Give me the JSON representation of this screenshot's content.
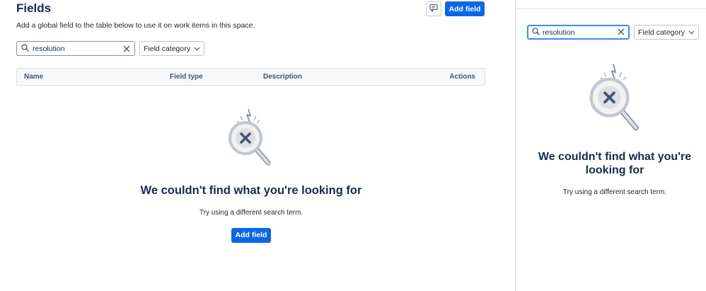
{
  "main": {
    "title": "Fields",
    "subtitle": "Add a global field to the table below to use it on work items in this space.",
    "add_field_label": "Add field",
    "feedback_icon": "feedback-icon",
    "search": {
      "value": "resolution",
      "icon": "search-icon",
      "clear_icon": "close-icon"
    },
    "category_filter": {
      "label": "Field category",
      "icon": "chevron-down-icon"
    },
    "table": {
      "columns": [
        "Name",
        "Field type",
        "Description",
        "Actions"
      ]
    },
    "empty_state": {
      "heading": "We couldn't find what you're looking for",
      "description": "Try using a different search term.",
      "button_label": "Add field",
      "illustration": "magnifier-no-results-icon"
    }
  },
  "side_panel": {
    "search": {
      "value": "resolution",
      "icon": "search-icon",
      "clear_icon": "close-icon"
    },
    "category_filter": {
      "label": "Field category",
      "icon": "chevron-down-icon"
    },
    "empty_state": {
      "heading": "We couldn't find what you're looking for",
      "description": "Try using a different search term.",
      "illustration": "magnifier-no-results-icon"
    }
  },
  "colors": {
    "primary": "#0c66e4",
    "focus_border": "#388bff",
    "text": "#172b4d",
    "border": "#dcdfe4"
  }
}
